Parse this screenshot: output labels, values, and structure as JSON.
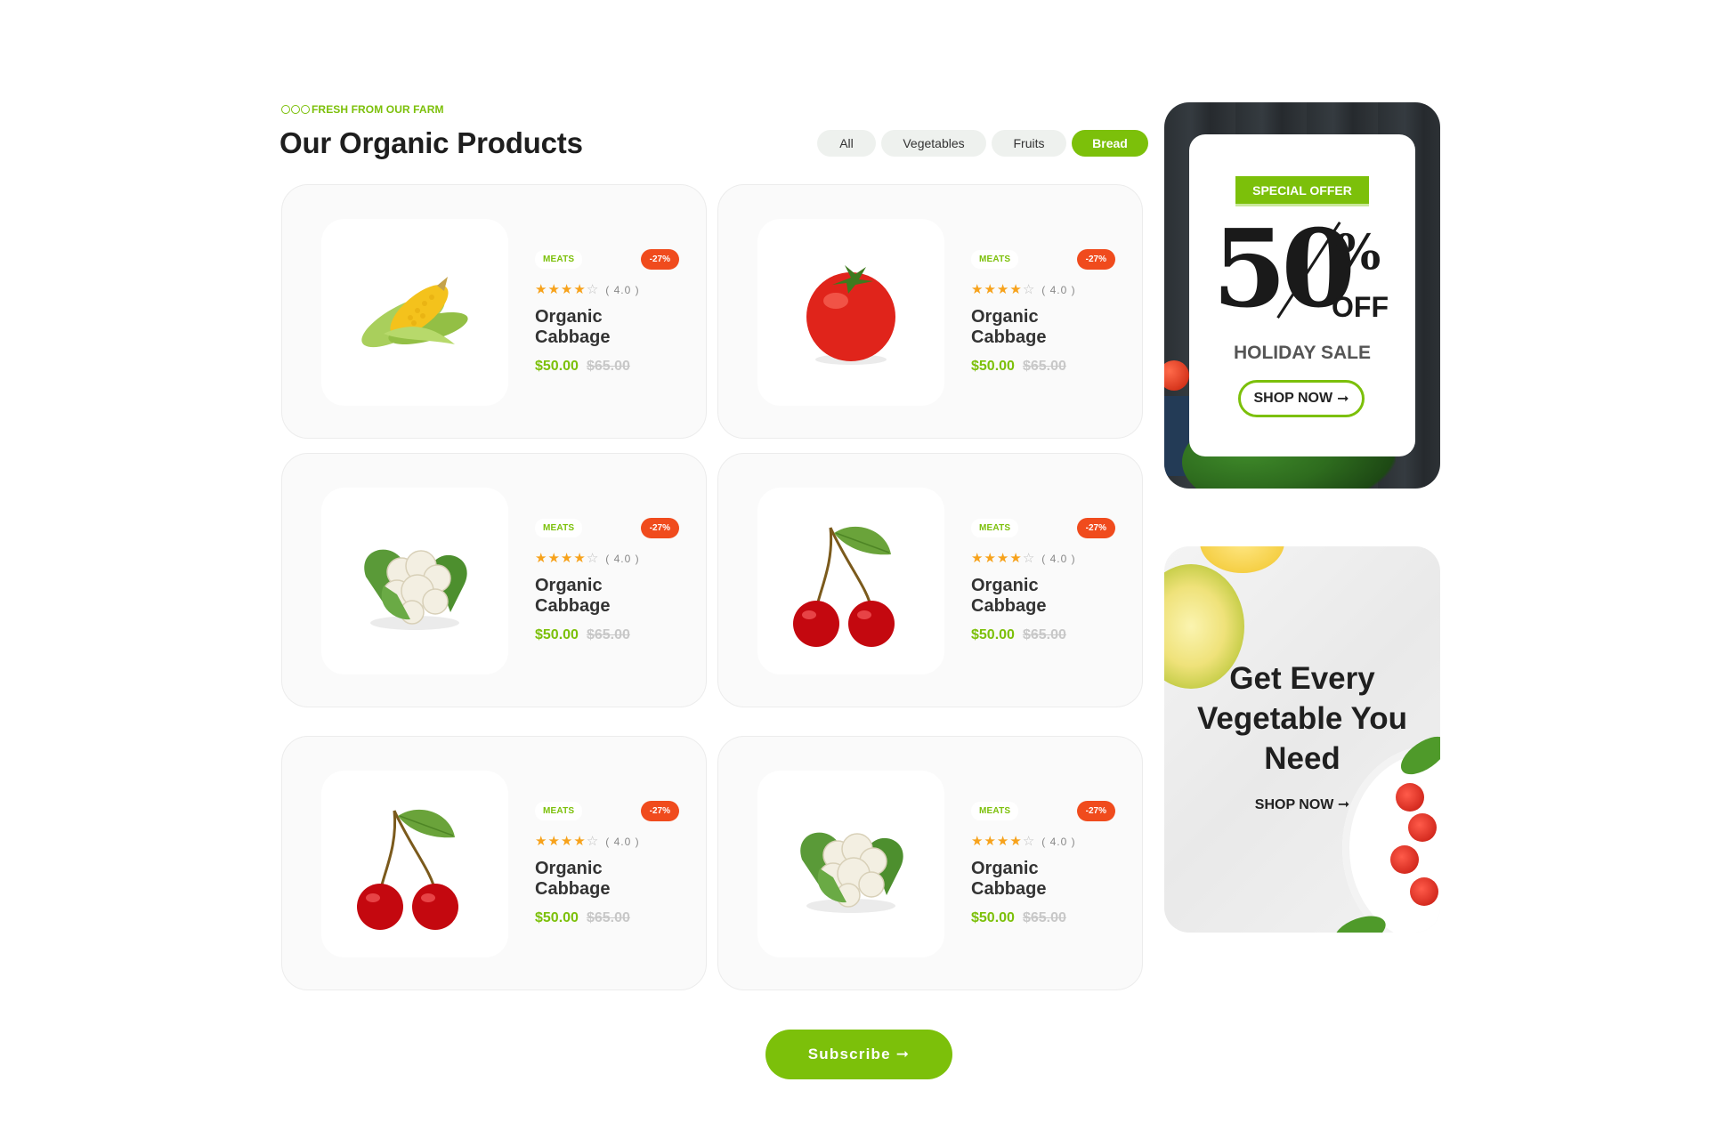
{
  "header": {
    "eyebrow": "FRESH FROM OUR FARM",
    "title": "Our Organic Products"
  },
  "filters": [
    {
      "label": "All",
      "active": false
    },
    {
      "label": "Vegetables",
      "active": false
    },
    {
      "label": "Fruits",
      "active": false
    },
    {
      "label": "Bread",
      "active": true
    }
  ],
  "products": [
    {
      "image": "corn",
      "category": "MEATS",
      "discount": "-27%",
      "rating": 4,
      "rating_text": "( 4.0 )",
      "name": "Organic Cabbage",
      "price": "$50.00",
      "old_price": "$65.00"
    },
    {
      "image": "tomato",
      "category": "MEATS",
      "discount": "-27%",
      "rating": 4,
      "rating_text": "( 4.0 )",
      "name": "Organic Cabbage",
      "price": "$50.00",
      "old_price": "$65.00"
    },
    {
      "image": "cauliflower",
      "category": "MEATS",
      "discount": "-27%",
      "rating": 4,
      "rating_text": "( 4.0 )",
      "name": "Organic Cabbage",
      "price": "$50.00",
      "old_price": "$65.00"
    },
    {
      "image": "cherry",
      "category": "MEATS",
      "discount": "-27%",
      "rating": 4,
      "rating_text": "( 4.0 )",
      "name": "Organic Cabbage",
      "price": "$50.00",
      "old_price": "$65.00"
    },
    {
      "image": "cherry",
      "category": "MEATS",
      "discount": "-27%",
      "rating": 4,
      "rating_text": "( 4.0 )",
      "name": "Organic Cabbage",
      "price": "$50.00",
      "old_price": "$65.00"
    },
    {
      "image": "cauliflower",
      "category": "MEATS",
      "discount": "-27%",
      "rating": 4,
      "rating_text": "( 4.0 )",
      "name": "Organic Cabbage",
      "price": "$50.00",
      "old_price": "$65.00"
    }
  ],
  "promo_offer": {
    "badge": "SPECIAL OFFER",
    "amount": "50",
    "percent_sign": "%",
    "off": "OFF",
    "subtitle": "HOLIDAY SALE",
    "button": "SHOP NOW",
    "button_arrow": "➞"
  },
  "promo_vegetables": {
    "heading_lines": [
      "Get Every",
      "Vegetable You",
      "Need"
    ],
    "button": "SHOP NOW",
    "button_arrow": "➞"
  },
  "subscribe": {
    "label": "Subscribe",
    "arrow": "➞"
  },
  "colors": {
    "accent": "#7cc00a",
    "discount": "#f04b1d",
    "star": "#f7a21b"
  }
}
